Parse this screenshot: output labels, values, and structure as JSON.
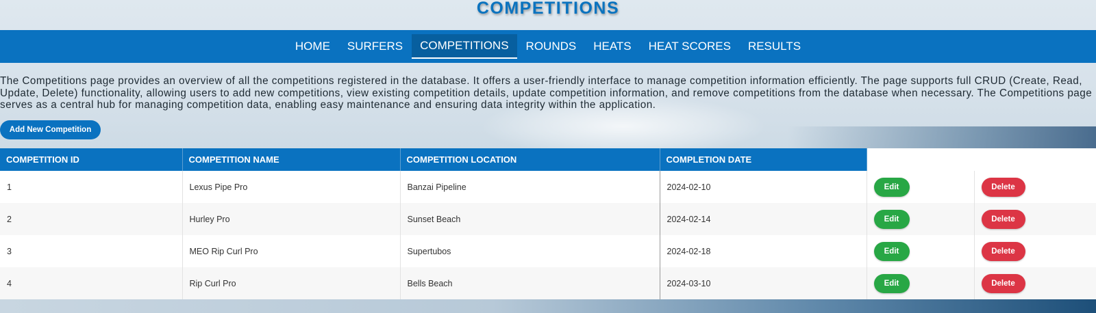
{
  "page": {
    "title": "COMPETITIONS",
    "description": "The Competitions page provides an overview of all the competitions registered in the database. It offers a user-friendly interface to manage competition information efficiently. The page supports full CRUD (Create, Read, Update, Delete) functionality, allowing users to add new competitions, view existing competition details, update competition information, and remove competitions from the database when necessary. The Competitions page serves as a central hub for managing competition data, enabling easy maintenance and ensuring data integrity within the application.",
    "add_button_label": "Add New Competition"
  },
  "nav": {
    "active": "COMPETITIONS",
    "items": [
      {
        "label": "HOME"
      },
      {
        "label": "SURFERS"
      },
      {
        "label": "COMPETITIONS"
      },
      {
        "label": "ROUNDS"
      },
      {
        "label": "HEATS"
      },
      {
        "label": "HEAT SCORES"
      },
      {
        "label": "RESULTS"
      }
    ]
  },
  "table": {
    "headers": [
      "COMPETITION ID",
      "COMPETITION NAME",
      "COMPETITION LOCATION",
      "COMPLETION DATE"
    ],
    "edit_label": "Edit",
    "delete_label": "Delete",
    "rows": [
      {
        "id": "1",
        "name": "Lexus Pipe Pro",
        "location": "Banzai Pipeline",
        "date": "2024-02-10"
      },
      {
        "id": "2",
        "name": "Hurley Pro",
        "location": "Sunset Beach",
        "date": "2024-02-14"
      },
      {
        "id": "3",
        "name": "MEO Rip Curl Pro",
        "location": "Supertubos",
        "date": "2024-02-18"
      },
      {
        "id": "4",
        "name": "Rip Curl Pro",
        "location": "Bells Beach",
        "date": "2024-03-10"
      }
    ]
  },
  "colors": {
    "primary": "#0a72c0",
    "edit": "#28a745",
    "delete": "#dc3545"
  }
}
